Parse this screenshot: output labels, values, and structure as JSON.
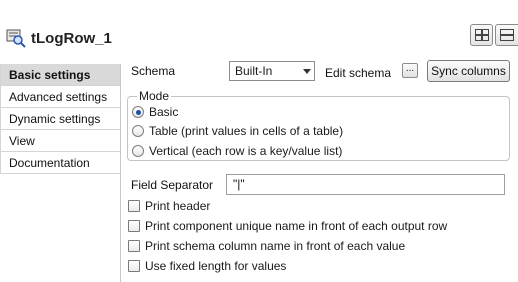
{
  "title": "tLogRow_1",
  "sidebar": {
    "items": [
      {
        "label": "Basic settings",
        "active": true
      },
      {
        "label": "Advanced settings",
        "active": false
      },
      {
        "label": "Dynamic settings",
        "active": false
      },
      {
        "label": "View",
        "active": false
      },
      {
        "label": "Documentation",
        "active": false
      }
    ]
  },
  "schema": {
    "label": "Schema",
    "value": "Built-In",
    "edit_label": "Edit schema",
    "edit_button": "...",
    "sync_button": "Sync columns"
  },
  "mode": {
    "legend": "Mode",
    "options": [
      {
        "label": "Basic",
        "selected": true
      },
      {
        "label": "Table (print values in cells of a table)",
        "selected": false
      },
      {
        "label": "Vertical (each row is a key/value list)",
        "selected": false
      }
    ]
  },
  "field_separator": {
    "label": "Field Separator",
    "value": "\"|\""
  },
  "checkboxes": [
    {
      "label": "Print header",
      "checked": false
    },
    {
      "label": "Print component unique name in front of each output row",
      "checked": false
    },
    {
      "label": "Print schema column name in front of each value",
      "checked": false
    },
    {
      "label": "Use fixed length for values",
      "checked": false
    }
  ],
  "colors": {
    "sidebar_active": "#d9d9d9",
    "radio_selected": "#1f4fa3"
  }
}
